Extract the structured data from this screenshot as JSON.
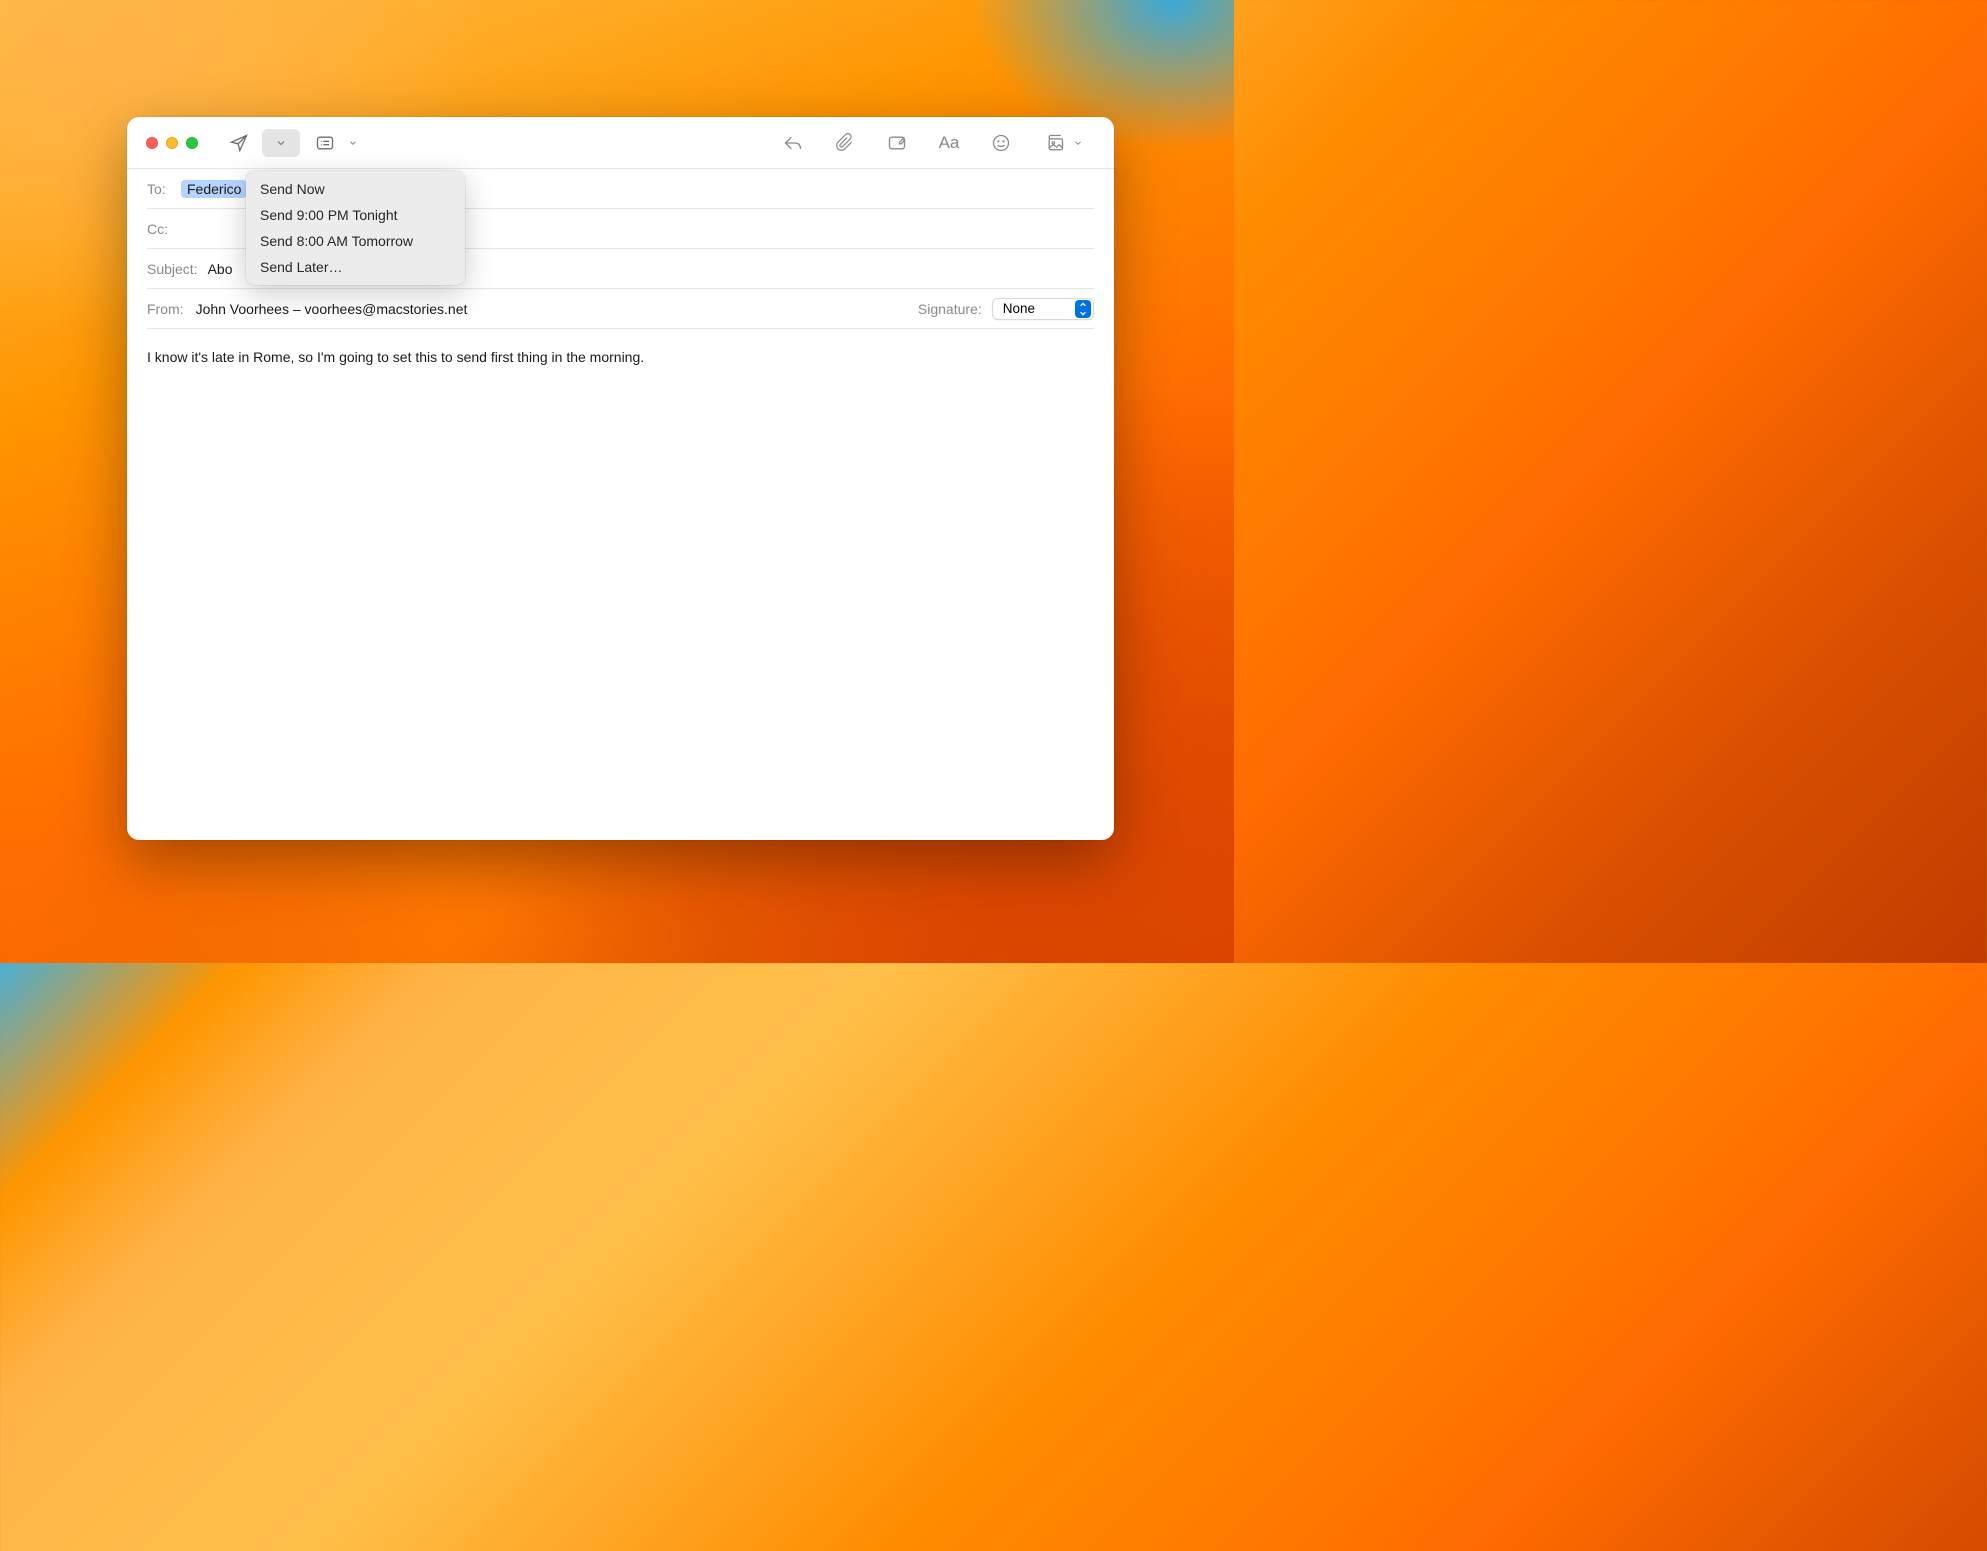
{
  "fields": {
    "to_label": "To:",
    "to_recipient": "Federico",
    "cc_label": "Cc:",
    "subject_label": "Subject:",
    "subject_value_visible": "Abo",
    "from_label": "From:",
    "from_value": "John Voorhees – voorhees@macstories.net",
    "signature_label": "Signature:",
    "signature_value": "None"
  },
  "body": {
    "text": "I know it's late in Rome, so I'm going to set this to send first thing in the morning."
  },
  "menu": {
    "items": [
      "Send Now",
      "Send 9:00 PM Tonight",
      "Send 8:00 AM Tomorrow",
      "Send Later…"
    ]
  },
  "toolbar": {
    "font_label": "Aa"
  }
}
